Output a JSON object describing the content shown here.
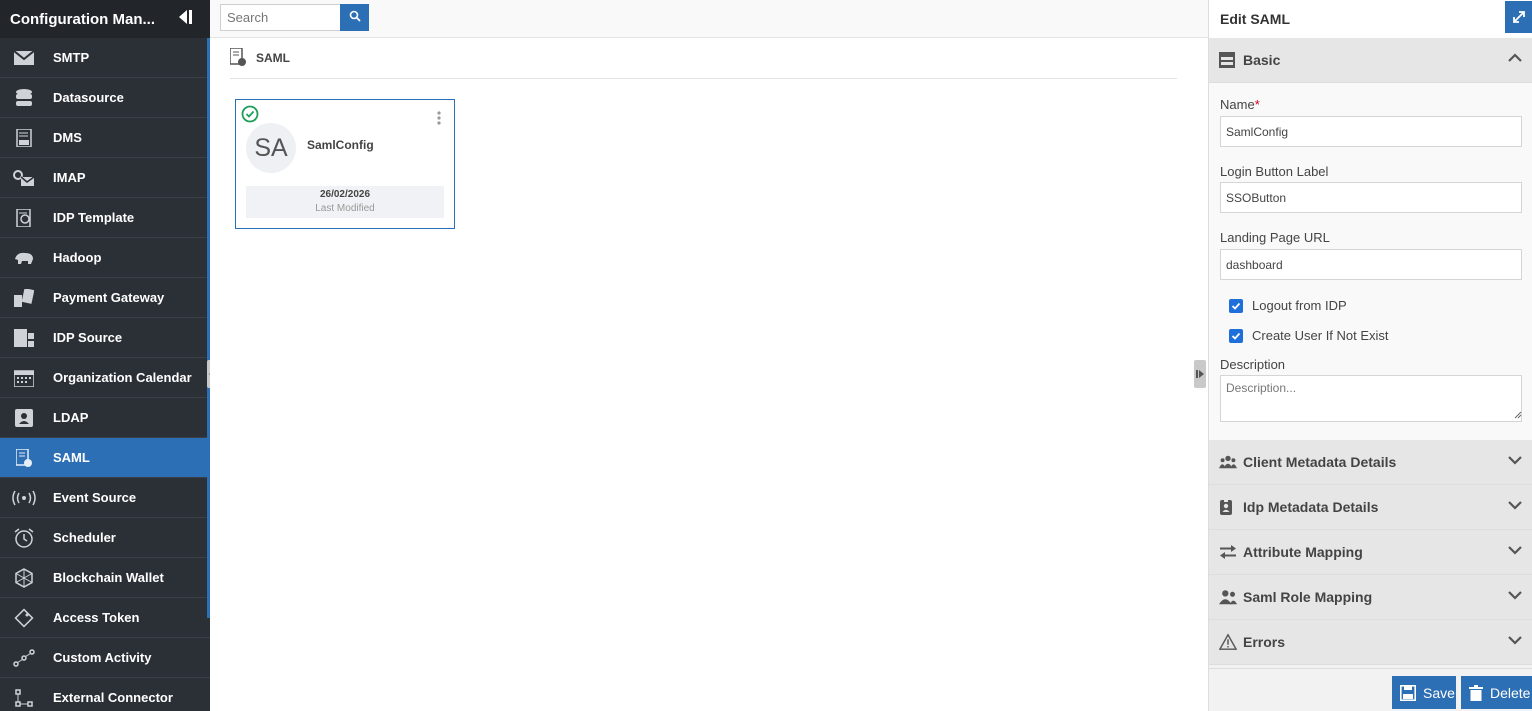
{
  "sidebar": {
    "title": "Configuration Man...",
    "items": [
      {
        "label": "SMTP",
        "icon": "envelope-icon"
      },
      {
        "label": "Datasource",
        "icon": "database-icon"
      },
      {
        "label": "DMS",
        "icon": "dms-icon"
      },
      {
        "label": "IMAP",
        "icon": "imap-icon"
      },
      {
        "label": "IDP Template",
        "icon": "idp-template-icon"
      },
      {
        "label": "Hadoop",
        "icon": "hadoop-elephant-icon"
      },
      {
        "label": "Payment Gateway",
        "icon": "payment-gateway-icon"
      },
      {
        "label": "IDP Source",
        "icon": "idp-source-icon"
      },
      {
        "label": "Organization Calendar",
        "icon": "calendar-icon"
      },
      {
        "label": "LDAP",
        "icon": "ldap-contact-icon"
      },
      {
        "label": "SAML",
        "icon": "saml-icon"
      },
      {
        "label": "Event Source",
        "icon": "broadcast-icon"
      },
      {
        "label": "Scheduler",
        "icon": "alarm-clock-icon"
      },
      {
        "label": "Blockchain Wallet",
        "icon": "blockchain-icon"
      },
      {
        "label": "Access Token",
        "icon": "token-icon"
      },
      {
        "label": "Custom Activity",
        "icon": "custom-activity-icon"
      },
      {
        "label": "External Connector",
        "icon": "connector-icon"
      }
    ],
    "active": "SAML"
  },
  "main": {
    "search": {
      "placeholder": "Search",
      "value": ""
    },
    "breadcrumb": "SAML",
    "card": {
      "initials": "SA",
      "name": "SamlConfig",
      "date": "26/02/2026",
      "date_caption": "Last Modified",
      "status": "active"
    }
  },
  "panel": {
    "title": "Edit SAML",
    "basic": {
      "title": "Basic",
      "name_label": "Name",
      "name_required": "*",
      "name_value": "SamlConfig",
      "login_label": "Login Button Label",
      "login_value": "SSOButton",
      "landing_label": "Landing Page URL",
      "landing_value": "dashboard",
      "logout_label": "Logout from IDP",
      "logout_checked": true,
      "create_user_label": "Create User If Not Exist",
      "create_user_checked": true,
      "description_label": "Description",
      "description_placeholder": "Description..."
    },
    "sections": [
      {
        "label": "Client Metadata Details",
        "icon": "users-group-icon"
      },
      {
        "label": "Idp Metadata Details",
        "icon": "id-badge-icon"
      },
      {
        "label": "Attribute Mapping",
        "icon": "swap-arrows-icon"
      },
      {
        "label": "Saml Role Mapping",
        "icon": "user-roles-icon"
      },
      {
        "label": "Errors",
        "icon": "warning-icon"
      }
    ],
    "save_label": "Save",
    "delete_label": "Delete"
  },
  "colors": {
    "accent": "#2d6fb5",
    "sidebar_bg": "#2b3037",
    "success": "#1e9e5a"
  }
}
